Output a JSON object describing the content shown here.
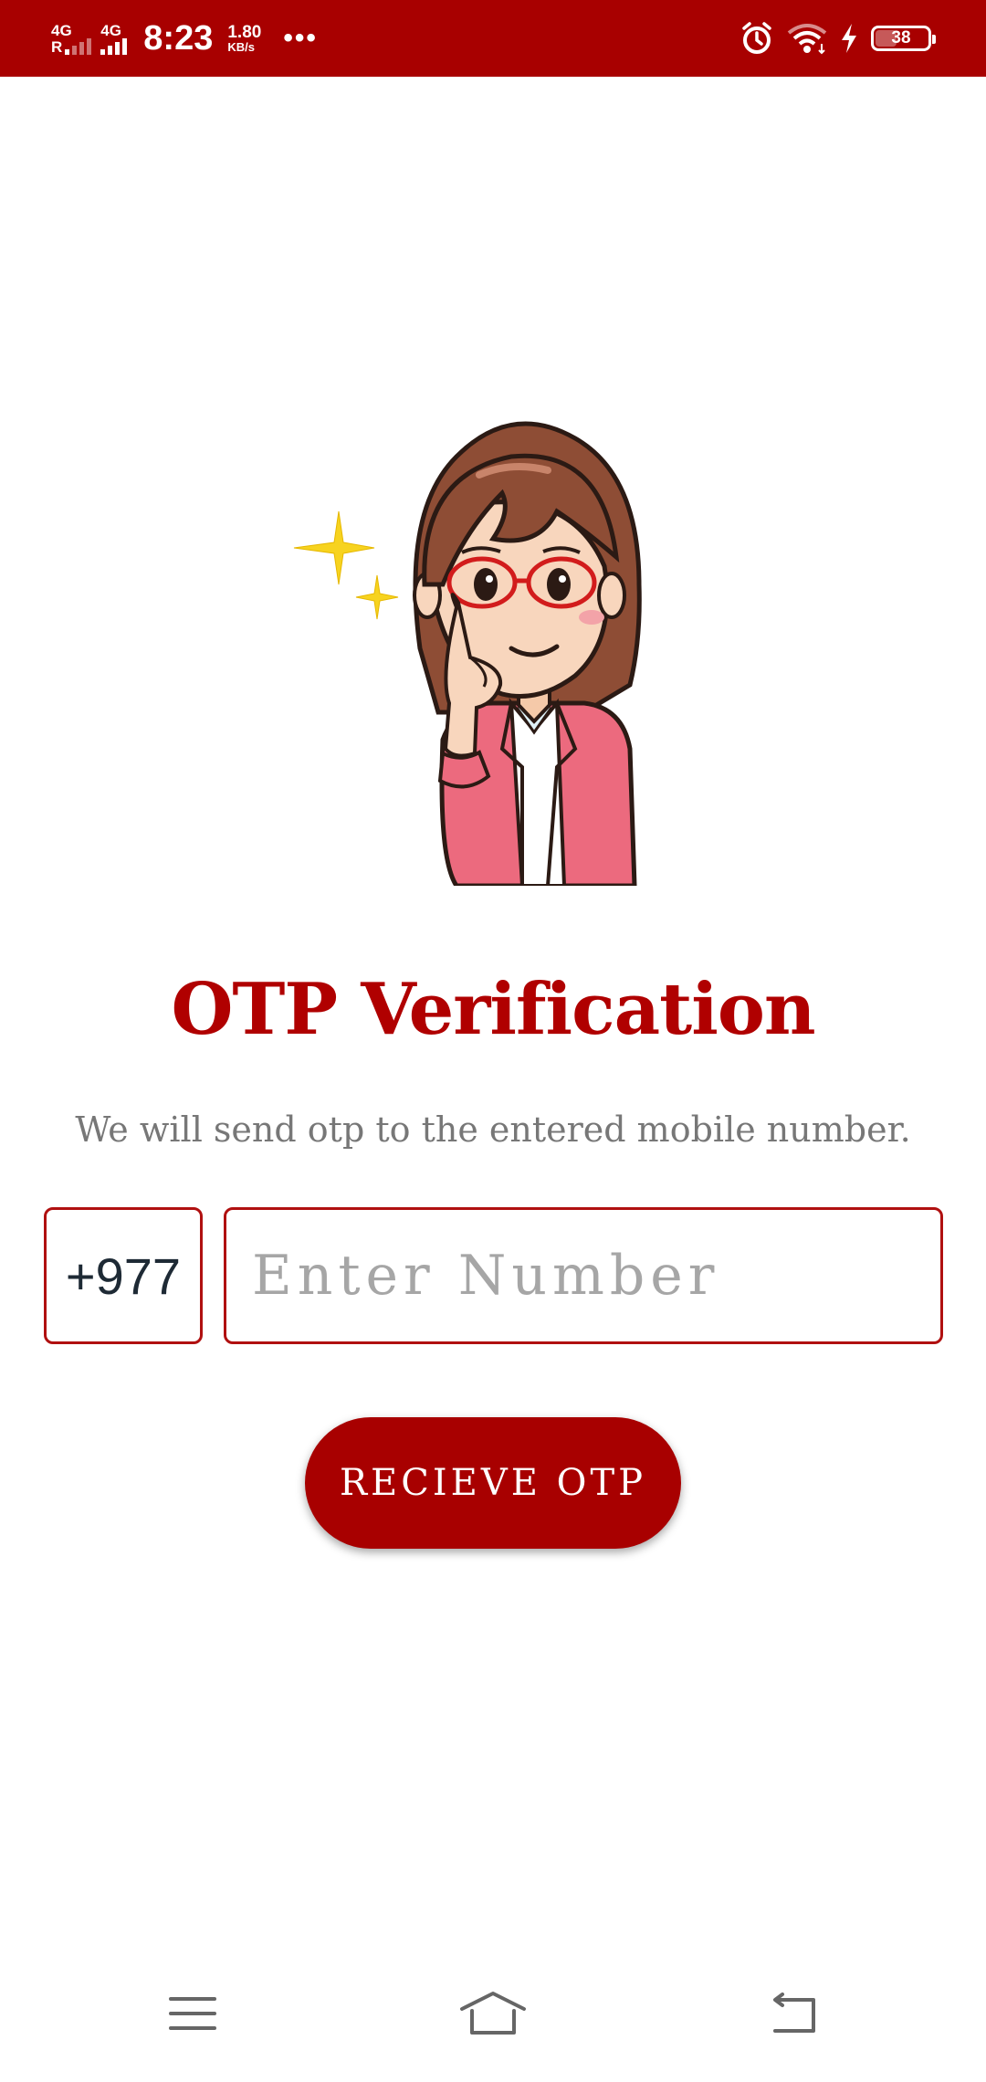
{
  "status_bar": {
    "network_1": "4G",
    "network_1_sub": "R",
    "network_2": "4G",
    "time": "8:23",
    "speed_value": "1.80",
    "speed_unit": "KB/s",
    "more": "•••",
    "battery": "38",
    "battery_level": 0.38,
    "icons": [
      "alarm-icon",
      "wifi-icon",
      "charging-icon",
      "battery-icon"
    ]
  },
  "page": {
    "title": "OTP Verification",
    "subtitle": "We will send otp to the entered mobile number.",
    "country_code": "+977",
    "phone_placeholder": "Enter Number",
    "phone_value": "",
    "button_label": "RECIEVE OTP"
  },
  "nav_bar": {
    "icons": [
      "menu-icon",
      "home-icon",
      "back-icon"
    ]
  },
  "colors": {
    "primary": "#a80000",
    "title": "#b00000",
    "subtitle": "#777777",
    "input_border": "#b01010"
  }
}
